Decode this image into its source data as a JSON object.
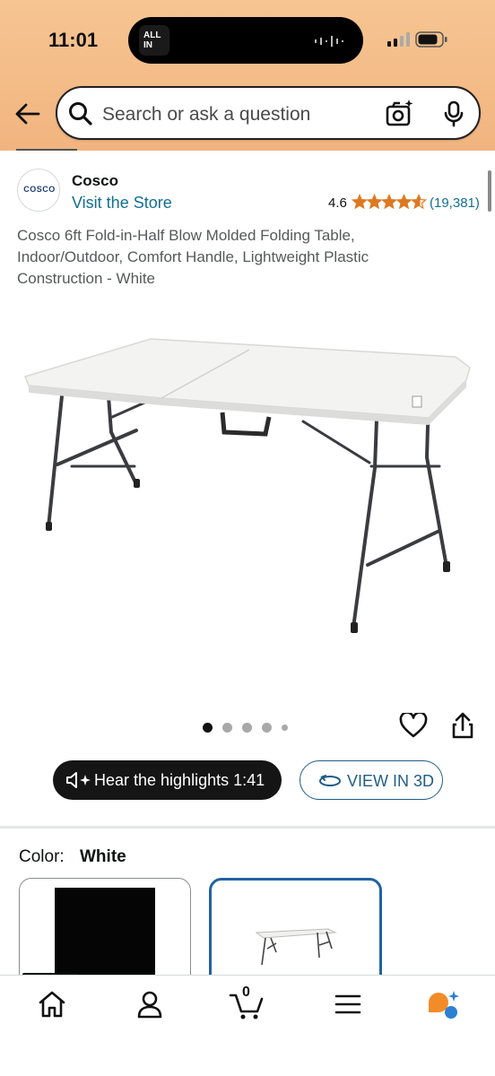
{
  "status": {
    "time": "11:01",
    "island_app": "ALL IN"
  },
  "search": {
    "placeholder": "Search or ask a question"
  },
  "store": {
    "logo_text": "COSCO",
    "brand": "Cosco",
    "visit": "Visit the Store",
    "rating": "4.6",
    "stars": 4.6,
    "review_count": "(19,381)"
  },
  "product": {
    "title": "Cosco 6ft Fold-in-Half Blow Molded Folding Table, Indoor/Outdoor, Comfort Handle, Lightweight Plastic Construction - White",
    "image_count": 5,
    "active_image": 1
  },
  "actions": {
    "hear_label": "Hear the highlights 1:41",
    "view3d_label": "VIEW IN 3D"
  },
  "variant": {
    "label": "Color:",
    "value": "White",
    "options": [
      "Black",
      "White"
    ],
    "selected": "White"
  },
  "tabbar": {
    "items": [
      "home-icon",
      "account-icon",
      "cart-icon",
      "menu-icon",
      "rufus-icon"
    ],
    "cart_count": "0",
    "active": "home"
  },
  "colors": {
    "header_band": "#f4bd8a",
    "link": "#136f91",
    "star": "#de7921",
    "selected_border": "#2162a1"
  }
}
